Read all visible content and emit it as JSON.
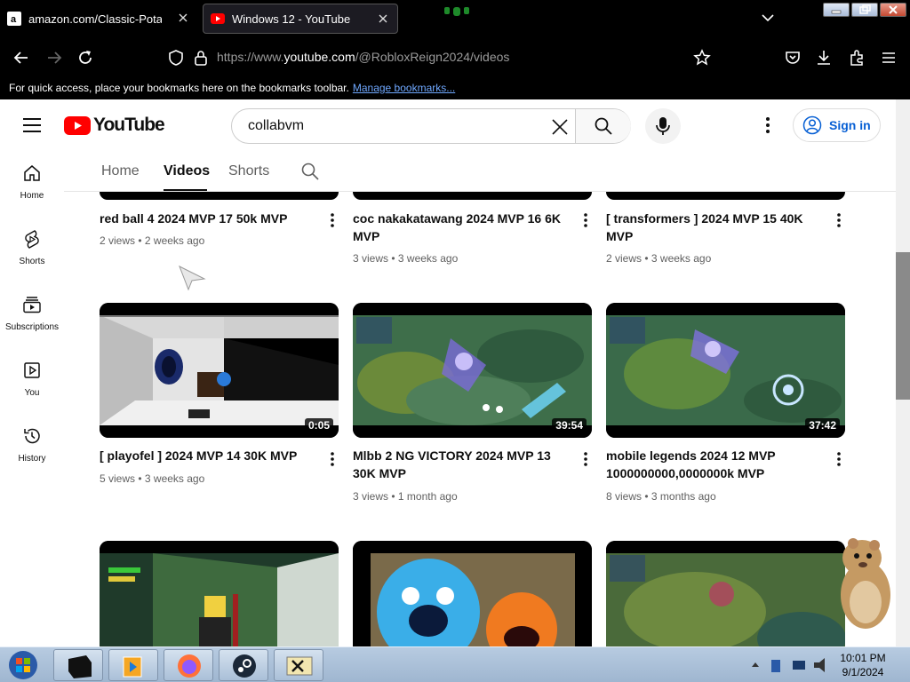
{
  "browser": {
    "tabs": [
      {
        "title": "amazon.com/Classic-Potato-Fa",
        "favicon": "amazon-icon",
        "active": false
      },
      {
        "title": "Windows 12 - YouTube",
        "favicon": "youtube-icon",
        "active": true
      }
    ],
    "url_prefix": "https://www.",
    "url_host": "youtube.com",
    "url_path": "/@RobloxReign2024/videos",
    "bookmarks_text": "For quick access, place your bookmarks here on the bookmarks toolbar.",
    "manage_bookmarks": "Manage bookmarks..."
  },
  "youtube": {
    "logo_text": "YouTube",
    "search_value": "collabvm",
    "sign_in": "Sign in",
    "sidebar": [
      {
        "label": "Home",
        "icon": "home-icon"
      },
      {
        "label": "Shorts",
        "icon": "shorts-icon"
      },
      {
        "label": "Subscriptions",
        "icon": "subscriptions-icon"
      },
      {
        "label": "You",
        "icon": "you-icon"
      },
      {
        "label": "History",
        "icon": "history-icon"
      }
    ],
    "channel_tabs": [
      "Home",
      "Videos",
      "Shorts"
    ],
    "active_tab": "Videos",
    "videos": [
      {
        "title": "red ball 4 2024 MVP 17 50k MVP",
        "views": "2 views",
        "age": "2 weeks ago",
        "duration": ""
      },
      {
        "title": "coc nakakatawang 2024 MVP 16 6K MVP",
        "views": "3 views",
        "age": "3 weeks ago",
        "duration": ""
      },
      {
        "title": "[ transformers ] 2024 MVP 15 40K MVP",
        "views": "2 views",
        "age": "3 weeks ago",
        "duration": ""
      },
      {
        "title": "[ playofel ] 2024 MVP 14 30K MVP",
        "views": "5 views",
        "age": "3 weeks ago",
        "duration": "0:05"
      },
      {
        "title": "Mlbb 2 NG VICTORY 2024 MVP 13 30K MVP",
        "views": "3 views",
        "age": "1 month ago",
        "duration": "39:54"
      },
      {
        "title": "mobile legends 2024 12 MVP 1000000000,0000000k MVP",
        "views": "8 views",
        "age": "3 months ago",
        "duration": "37:42"
      },
      {
        "title": "",
        "views": "",
        "age": "",
        "duration": ""
      },
      {
        "title": "",
        "views": "",
        "age": "",
        "duration": ""
      },
      {
        "title": "",
        "views": "",
        "age": "",
        "duration": ""
      }
    ],
    "meta_separator": "•"
  },
  "taskbar": {
    "time": "10:01 PM",
    "date": "9/1/2024"
  },
  "colors": {
    "yt_red": "#ff0000",
    "link_blue": "#065fd4"
  }
}
